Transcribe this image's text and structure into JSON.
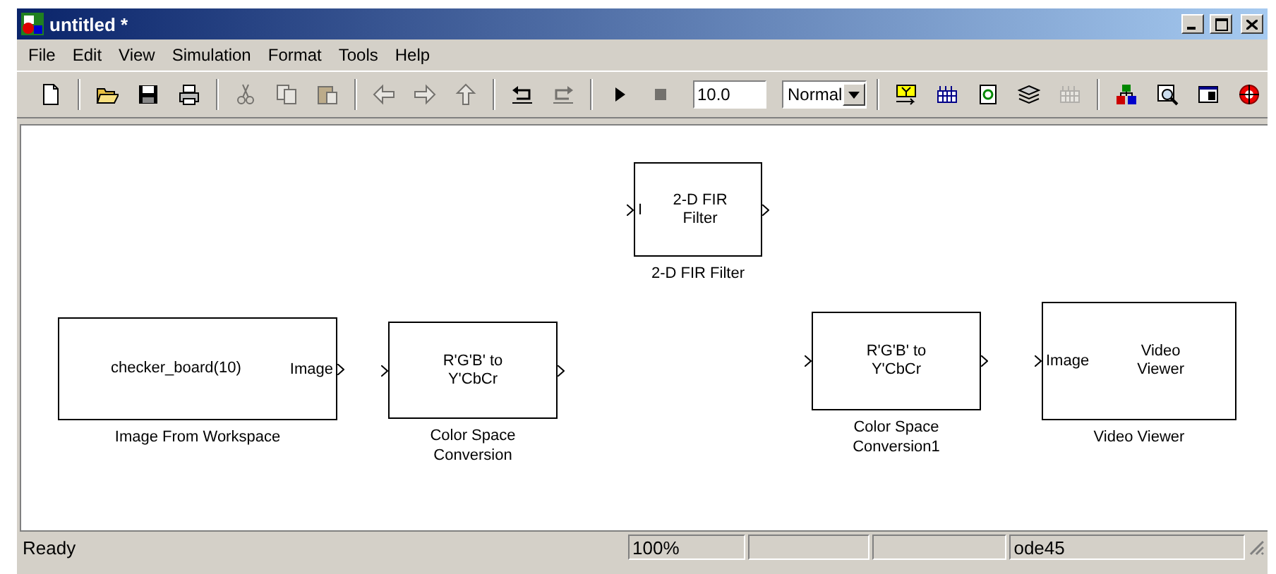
{
  "window": {
    "title": "untitled *"
  },
  "menu": [
    {
      "label": "File"
    },
    {
      "label": "Edit"
    },
    {
      "label": "View"
    },
    {
      "label": "Simulation"
    },
    {
      "label": "Format"
    },
    {
      "label": "Tools"
    },
    {
      "label": "Help"
    }
  ],
  "toolbar": [
    {
      "kind": "button",
      "disabled": false
    },
    {
      "kind": "separator"
    },
    {
      "kind": "button",
      "disabled": false
    },
    {
      "kind": "button",
      "disabled": false
    },
    {
      "kind": "button",
      "disabled": false
    },
    {
      "kind": "separator"
    },
    {
      "kind": "button",
      "disabled": true
    },
    {
      "kind": "button",
      "disabled": true
    },
    {
      "kind": "button",
      "disabled": true
    },
    {
      "kind": "separator"
    },
    {
      "kind": "button",
      "disabled": true
    },
    {
      "kind": "button",
      "disabled": true
    },
    {
      "kind": "button",
      "disabled": true
    },
    {
      "kind": "separator"
    },
    {
      "kind": "button",
      "disabled": false
    },
    {
      "kind": "button",
      "disabled": true
    },
    {
      "kind": "separator"
    },
    {
      "kind": "button",
      "disabled": false
    },
    {
      "kind": "button",
      "disabled": true
    },
    {
      "kind": "field",
      "value": "10.0"
    },
    {
      "kind": "dropdown",
      "value": "Normal"
    },
    {
      "kind": "separator"
    },
    {
      "kind": "button",
      "disabled": false
    },
    {
      "kind": "button",
      "disabled": false
    },
    {
      "kind": "button",
      "disabled": false
    },
    {
      "kind": "button",
      "disabled": false
    },
    {
      "kind": "button",
      "disabled": true
    },
    {
      "kind": "separator"
    },
    {
      "kind": "button",
      "disabled": false
    },
    {
      "kind": "button",
      "disabled": false
    },
    {
      "kind": "button",
      "disabled": false
    },
    {
      "kind": "button",
      "disabled": false
    }
  ],
  "blocks": [
    {
      "body": [
        "2-D FIR",
        "Filter"
      ],
      "has_input": true,
      "input_label": "I",
      "has_output": true,
      "caption": [
        "2-D FIR Filter"
      ]
    },
    {
      "body": [
        "checker_board(10)"
      ],
      "has_input": false,
      "has_output": true,
      "output_label": "Image",
      "caption": [
        "Image From Workspace"
      ]
    },
    {
      "body": [
        "R'G'B' to",
        "Y'CbCr"
      ],
      "has_input": true,
      "has_output": true,
      "caption": [
        "Color Space",
        "Conversion"
      ]
    },
    {
      "body": [
        "R'G'B' to",
        "Y'CbCr"
      ],
      "has_input": true,
      "has_output": true,
      "caption": [
        "Color Space",
        "Conversion1"
      ]
    },
    {
      "body": [
        "Video",
        "Viewer"
      ],
      "has_input": true,
      "input_label": "Image",
      "has_output": false,
      "caption": [
        "Video Viewer"
      ]
    }
  ],
  "status_bar": {
    "message": "Ready",
    "zoom": "100%",
    "solver": "ode45"
  }
}
